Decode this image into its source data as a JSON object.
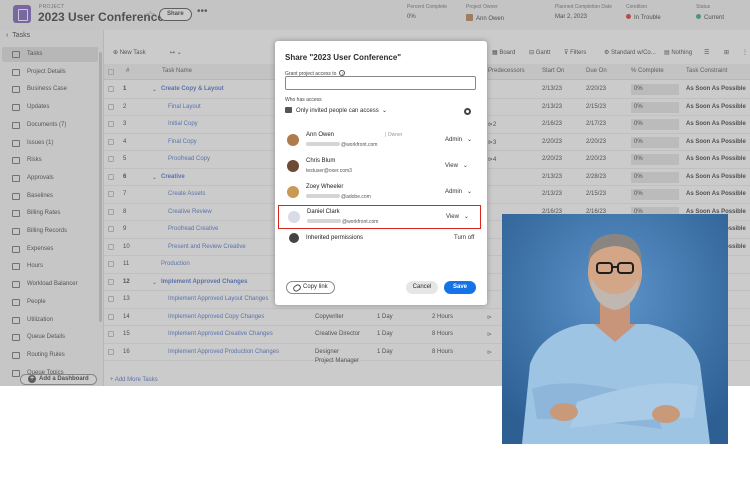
{
  "header": {
    "kicker": "PROJECT",
    "title": "2023 User Conference",
    "share_label": "Share",
    "more_label": "•••",
    "fields": [
      {
        "label": "Percent Complete",
        "value": "0%"
      },
      {
        "label": "Project Owner",
        "value": "Ann Owen"
      },
      {
        "label": "Planned Completion Date",
        "value": "Mar 2, 2023"
      },
      {
        "label": "Condition",
        "value": "In Trouble"
      },
      {
        "label": "Status",
        "value": "Current"
      }
    ],
    "colors": {
      "condition": "#d9251c",
      "status": "#2d9d78"
    }
  },
  "sidebar": {
    "back_label": "Tasks",
    "items": [
      {
        "label": "Tasks",
        "active": true,
        "icon": "tasks-icon"
      },
      {
        "label": "Project Details",
        "icon": "details-icon"
      },
      {
        "label": "Business Case",
        "icon": "business-case-icon"
      },
      {
        "label": "Updates",
        "icon": "updates-icon"
      },
      {
        "label": "Documents (7)",
        "icon": "documents-icon"
      },
      {
        "label": "Issues (1)",
        "icon": "issues-icon"
      },
      {
        "label": "Risks",
        "icon": "risks-icon"
      },
      {
        "label": "Approvals",
        "icon": "approvals-icon"
      },
      {
        "label": "Baselines",
        "icon": "baselines-icon"
      },
      {
        "label": "Billing Rates",
        "icon": "billing-rates-icon"
      },
      {
        "label": "Billing Records",
        "icon": "billing-records-icon"
      },
      {
        "label": "Expenses",
        "icon": "expenses-icon"
      },
      {
        "label": "Hours",
        "icon": "hours-icon"
      },
      {
        "label": "Workload Balancer",
        "icon": "workload-icon"
      },
      {
        "label": "People",
        "icon": "people-icon"
      },
      {
        "label": "Utilization",
        "icon": "utilization-icon"
      },
      {
        "label": "Queue Details",
        "icon": "queue-icon"
      },
      {
        "label": "Routing Rules",
        "icon": "routing-icon"
      },
      {
        "label": "Queue Topics",
        "icon": "topics-icon"
      }
    ],
    "add_dashboard_label": "Add a Dashboard"
  },
  "toolbar": {
    "new_task_label": "New Task",
    "board_label": "Board",
    "gantt_label": "Gantt",
    "filters_label": "Filters",
    "view_label": "Standard w/Co...",
    "group_label": "Nothing"
  },
  "table": {
    "columns": [
      "#",
      "Task Name",
      "Predecessors",
      "Start On",
      "Due On",
      "% Complete",
      "Task Constraint"
    ],
    "rows": [
      {
        "num": "1",
        "name": "Create Copy & Layout",
        "type": "group",
        "pred": "",
        "start": "2/13/23",
        "due": "2/20/23",
        "pct": "0%",
        "constraint": "As Soon As Possible",
        "extra": ""
      },
      {
        "num": "2",
        "name": "Final Layout",
        "type": "task",
        "pred": "",
        "start": "2/13/23",
        "due": "2/15/23",
        "pct": "0%",
        "constraint": "As Soon As Possible",
        "extra": ""
      },
      {
        "num": "3",
        "name": "Initial Copy",
        "type": "task",
        "pred": "2",
        "start": "2/16/23",
        "due": "2/17/23",
        "pct": "0%",
        "constraint": "As Soon As Possible",
        "extra": ""
      },
      {
        "num": "4",
        "name": "Final Copy",
        "type": "task",
        "pred": "3",
        "start": "2/20/23",
        "due": "2/20/23",
        "pct": "0%",
        "constraint": "As Soon As Possible",
        "extra": ""
      },
      {
        "num": "5",
        "name": "Proofread Copy",
        "type": "task",
        "pred": "4",
        "start": "2/20/23",
        "due": "2/20/23",
        "pct": "0%",
        "constraint": "As Soon As Possible",
        "extra": ""
      },
      {
        "num": "6",
        "name": "Creative",
        "type": "group",
        "pred": "",
        "start": "2/13/23",
        "due": "2/28/23",
        "pct": "0%",
        "constraint": "As Soon As Possible",
        "extra": ""
      },
      {
        "num": "7",
        "name": "Create Assets",
        "type": "task",
        "pred": "",
        "start": "2/13/23",
        "due": "2/15/23",
        "pct": "0%",
        "constraint": "As Soon As Possible",
        "extra": ""
      },
      {
        "num": "8",
        "name": "Creative Review",
        "type": "task",
        "pred": "",
        "start": "2/16/23",
        "due": "2/16/23",
        "pct": "0%",
        "constraint": "As Soon As Possible",
        "extra": ""
      },
      {
        "num": "9",
        "name": "Proofread Creative",
        "type": "task",
        "pred": "",
        "start": "2/17/23",
        "due": "2/20/23",
        "pct": "0%",
        "constraint": "As Soon As Possible",
        "extra": ""
      },
      {
        "num": "10",
        "name": "Present and Review Creative",
        "type": "task",
        "pred": "",
        "start": "2/21/23",
        "due": "2/28/23",
        "pct": "0%",
        "constraint": "As Soon As Possible",
        "extra": ""
      },
      {
        "num": "11",
        "name": "Production",
        "type": "task",
        "pred": "",
        "start": "",
        "due": "",
        "pct": "",
        "constraint": "",
        "extra": ""
      },
      {
        "num": "12",
        "name": "Implement Approved Changes",
        "type": "group",
        "pred": "",
        "start": "",
        "due": "",
        "pct": "",
        "constraint": "",
        "extra": ""
      },
      {
        "num": "13",
        "name": "Implement Approved Layout Changes",
        "type": "task",
        "pred": "",
        "start": "",
        "due": "",
        "pct": "",
        "constraint": "",
        "extra": ""
      },
      {
        "num": "14",
        "name": "Implement Approved Copy Changes",
        "type": "task",
        "pred": "",
        "start": "",
        "due": "",
        "pct": "",
        "constraint": "",
        "extra": "Copywriter|1 Day|2 Hours"
      },
      {
        "num": "15",
        "name": "Implement Approved Creative Changes",
        "type": "task",
        "pred": "",
        "start": "",
        "due": "",
        "pct": "",
        "constraint": "",
        "extra": "Creative Director|1 Day|8 Hours"
      },
      {
        "num": "16",
        "name": "Implement Approved Production Changes",
        "type": "task",
        "pred": "",
        "start": "",
        "due": "",
        "pct": "",
        "constraint": "",
        "extra": "Designer|1 Day|8 Hours"
      }
    ],
    "row16_second_role": "Project Manager",
    "add_more_label": "+ Add More Tasks"
  },
  "modal": {
    "title": "Share \"2023 User Conference\"",
    "grant_label": "Grant project access to",
    "input_placeholder": "",
    "who_label": "Who has access",
    "access_label": "Only invited people can access",
    "people": [
      {
        "name": "Ann Owen",
        "email": "@workfront.com",
        "role": "Admin",
        "owner": "Owner",
        "avatar_color": "#b07b4a"
      },
      {
        "name": "Chris Blum",
        "email": "testuser@oxer.com3",
        "role": "View",
        "owner": "",
        "avatar_color": "#6d4a35"
      },
      {
        "name": "Zoey Wheeler",
        "email": "@adobe.com",
        "role": "Admin",
        "owner": "",
        "avatar_color": "#c89a55"
      },
      {
        "name": "Daniel Clark",
        "email": "@workfront.com",
        "role": "View",
        "owner": "",
        "avatar_color": "#d8dce4"
      }
    ],
    "inherited_label": "Inherited permissions",
    "turn_off_label": "Turn off",
    "copy_link_label": "Copy link",
    "cancel_label": "Cancel",
    "save_label": "Save"
  }
}
